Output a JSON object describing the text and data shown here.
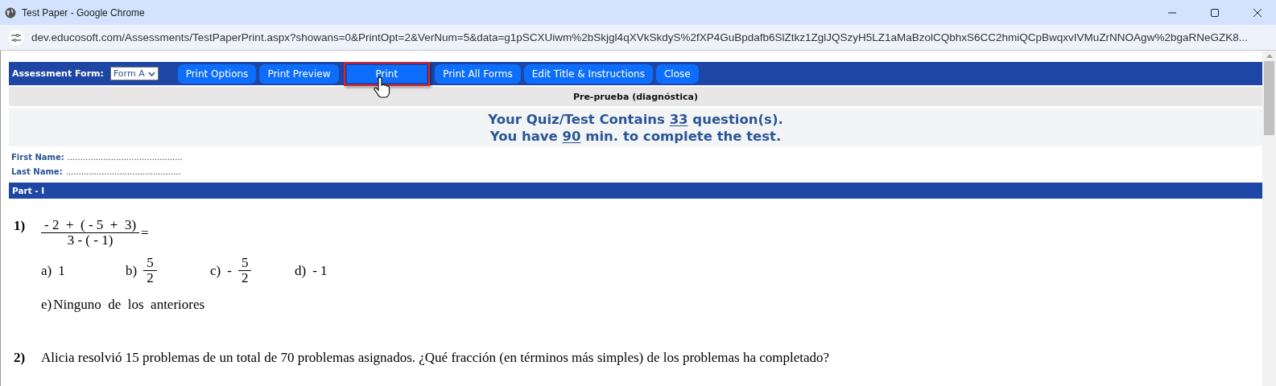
{
  "window": {
    "title": "Test Paper - Google Chrome"
  },
  "address_bar": {
    "url": "dev.educosoft.com/Assessments/TestPaperPrint.aspx?showans=0&PrintOpt=2&VerNum=5&data=g1pSCXUiwm%2bSkjgl4qXVkSkdyS%2fXP4GuBpdafb6SlZtkz1ZglJQSzyH5LZ1aMaBzolCQbhxS6CC2hmiQCpBwqxvIVMuZrNNOAgw%2bgaRNeGZK8..."
  },
  "toolbar": {
    "form_label": "Assessment Form:",
    "form_select": "Form A",
    "buttons": [
      {
        "label": "Print Options",
        "highlighted": false
      },
      {
        "label": "Print Preview",
        "highlighted": false
      },
      {
        "label": "Print",
        "highlighted": true
      },
      {
        "label": "Print All Forms",
        "highlighted": false
      },
      {
        "label": "Edit Title & Instructions",
        "highlighted": false
      },
      {
        "label": "Close",
        "highlighted": false
      }
    ]
  },
  "subtitle": "Pre-prueba (diagnóstica)",
  "banner": [
    {
      "before": "Your Quiz/Test Contains ",
      "number": "33",
      "after": " question(s)."
    },
    {
      "before": "You have ",
      "number": "90",
      "after": " min. to complete the test."
    }
  ],
  "name_fields": [
    {
      "label": "First Name:",
      "line": "............................................."
    },
    {
      "label": "Last Name:",
      "line": "............................................."
    }
  ],
  "section": "Part - I",
  "questions": [
    {
      "number": "1)",
      "kind": "fraction",
      "numerator": "- 2  +  ( - 5  +  3)",
      "denominator": "3 - ( - 1)",
      "suffix": "=",
      "options": [
        {
          "letter": "a)",
          "kind": "text",
          "text": "1"
        },
        {
          "letter": "b)",
          "kind": "fraction",
          "numerator": "5",
          "denominator": "2"
        },
        {
          "letter": "c)",
          "kind": "fraction",
          "sign": "-",
          "numerator": "5",
          "denominator": "2"
        },
        {
          "letter": "d)",
          "kind": "text",
          "text": "- 1"
        },
        {
          "letter": "e)",
          "kind": "wide",
          "text": "Ninguno  de  los  anteriores"
        }
      ]
    },
    {
      "number": "2)",
      "kind": "text",
      "text": "Alicia resolvió 15 problemas de un total de 70 problemas asignados. ¿Qué fracción (en términos más simples) de los problemas ha completado?"
    }
  ]
}
